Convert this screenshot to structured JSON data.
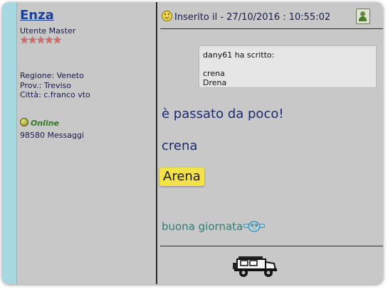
{
  "user": {
    "name": "Enza",
    "rank": "Utente Master",
    "stars": "★★★★★",
    "region": "Regione: Veneto",
    "province": "Prov.: Treviso",
    "city": "Città: c.franco vto",
    "status": "Online",
    "messages": "98580 Messaggi"
  },
  "post": {
    "header": "Inserito il - 27/10/2016 : 10:55:02",
    "quote": {
      "author": "dany61 ha scritto:",
      "lines": [
        "crena",
        "Drena"
      ]
    },
    "body": [
      "è passato da poco!",
      "crena",
      "Arena"
    ],
    "greeting": "buona giornata"
  },
  "icons": {
    "header_icon": "smiley-icon",
    "profile_icon": "user-profile-icon",
    "online_icon": "online-status-icon",
    "emoticon": "bird-emoticon-icon",
    "signature": "jeep-image"
  },
  "colors": {
    "username": "#1b3f9c",
    "online": "#2e7a1f",
    "highlight": "#f4e24a",
    "accent": "#a9d9e0",
    "panel": "#c8c8c8"
  }
}
